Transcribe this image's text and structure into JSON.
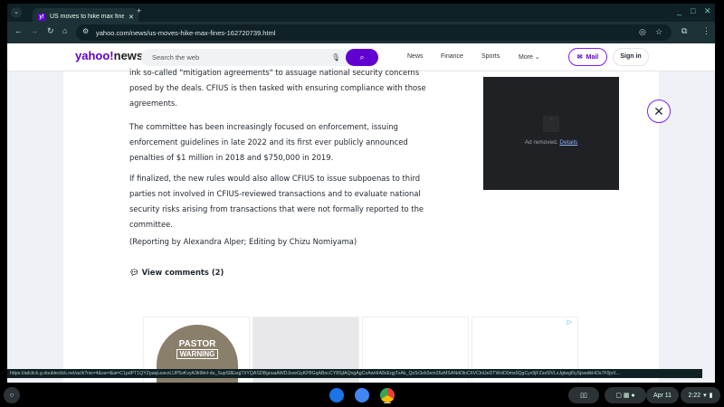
{
  "browser": {
    "tab_title": "US moves to hike max fines to...",
    "url": "yahoo.com/news/us-moves-hike-max-fines-162720739.html",
    "tab_close": "✕",
    "new_tab": "+"
  },
  "yahoo": {
    "logo_main": "yahoo",
    "logo_sep": "!",
    "logo_section": "news",
    "search_placeholder": "Search the web",
    "nav": [
      "News",
      "Finance",
      "Sports",
      "More ⌄"
    ],
    "mail": "Mail",
    "signin": "Sign in"
  },
  "article": {
    "paragraphs": [
      [
        "ink so-called \"mitigation agreements\" to assuage national security concerns",
        "posed by the deals. CFIUS is then tasked with ensuring compliance with those",
        "agreements."
      ],
      [
        "The committee has been increasingly focused on enforcement, issuing",
        "enforcement guidelines in late 2022 and its first ever publicly announced",
        "penalties of $1 million in 2018 and $750,000 in 2019."
      ],
      [
        "If finalized, the new rules would also allow CFIUS to issue subpoenas to third",
        "parties not involved in CFIUS-reviewed transactions and to evaluate national",
        "security risks arising from transactions that were not formally reported to the",
        "committee."
      ],
      [
        "(Reporting by Alexandra Alper; Editing by Chizu Nomiyama)"
      ]
    ],
    "comments": "View comments (2)"
  },
  "ad": {
    "removed": "Ad removed.",
    "details": "Details",
    "hat_text": "PASTOR",
    "hat_text2": "WARNING"
  },
  "status_url": "https://adclick.g.doubleclick.net/aclk?nis=4&sa=l&ai=C1pdPT1QYZpaqLeavzLUP5sKvyA3k9bH-du_SupS8Esqj7XYQASDBgouaAWDJxveGyKP8GqABocCY8SjIAQngAgCoAwHIA8sEqgTxAk_QsSr3zb3em26zMSANdOlnC6VClnlJeDTWxlD0ms0QgCyx9jFZssSlVLxJgtwgl5ySjswdkHOs7F0jvX...",
  "shelf": {
    "date": "Apr 11",
    "time": "2:22"
  }
}
